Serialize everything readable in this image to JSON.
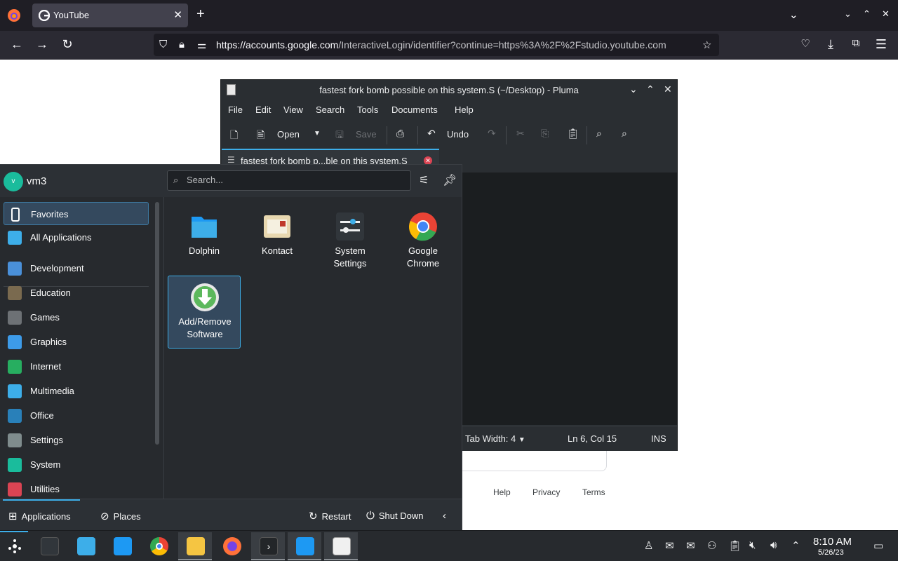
{
  "browser": {
    "tab_title": "YouTube",
    "url_domain": "https://accounts.google.com",
    "url_rest": "/InteractiveLogin/identifier?continue=https%3A%2F%2Fstudio.youtube.com",
    "new_tab": "+",
    "tab_close": "✕"
  },
  "page": {
    "footer_links": [
      "Help",
      "Privacy",
      "Terms"
    ]
  },
  "pluma": {
    "title": "fastest fork bomb possible on this system.S (~/Desktop) - Pluma",
    "menu": [
      "File",
      "Edit",
      "View",
      "Search",
      "Tools",
      "Documents",
      "Help"
    ],
    "toolbar": {
      "open": "Open",
      "save": "Save",
      "undo": "Undo"
    },
    "tab_label": "fastest fork bomb p...ble on this system.S",
    "status": {
      "tab_width": "Tab Width:  4",
      "position": "Ln 6, Col 15",
      "mode": "INS"
    }
  },
  "launcher": {
    "user": "vm3",
    "avatar_letter": "v",
    "search_placeholder": "Search...",
    "categories": [
      {
        "label": "Favorites",
        "color": "#2c3035"
      },
      {
        "label": "All Applications",
        "color": "#3daee9"
      },
      {
        "label": "Development",
        "color": "#4a90d9"
      },
      {
        "label": "Education",
        "color": "#7a6a4f"
      },
      {
        "label": "Games",
        "color": "#6d7175"
      },
      {
        "label": "Graphics",
        "color": "#3d9be9"
      },
      {
        "label": "Internet",
        "color": "#27ae60"
      },
      {
        "label": "Multimedia",
        "color": "#3daee9"
      },
      {
        "label": "Office",
        "color": "#2980b9"
      },
      {
        "label": "Settings",
        "color": "#7f8c8d"
      },
      {
        "label": "System",
        "color": "#1abc9c"
      },
      {
        "label": "Utilities",
        "color": "#da4453"
      }
    ],
    "apps": [
      {
        "label1": "Dolphin",
        "label2": ""
      },
      {
        "label1": "Kontact",
        "label2": ""
      },
      {
        "label1": "System",
        "label2": "Settings"
      },
      {
        "label1": "Google",
        "label2": "Chrome"
      },
      {
        "label1": "Add/Remove",
        "label2": "Software"
      }
    ],
    "footer": {
      "applications": "Applications",
      "places": "Places",
      "restart": "Restart",
      "shutdown": "Shut Down"
    }
  },
  "taskbar": {
    "clock_time": "8:10 AM",
    "clock_date": "5/26/23"
  }
}
